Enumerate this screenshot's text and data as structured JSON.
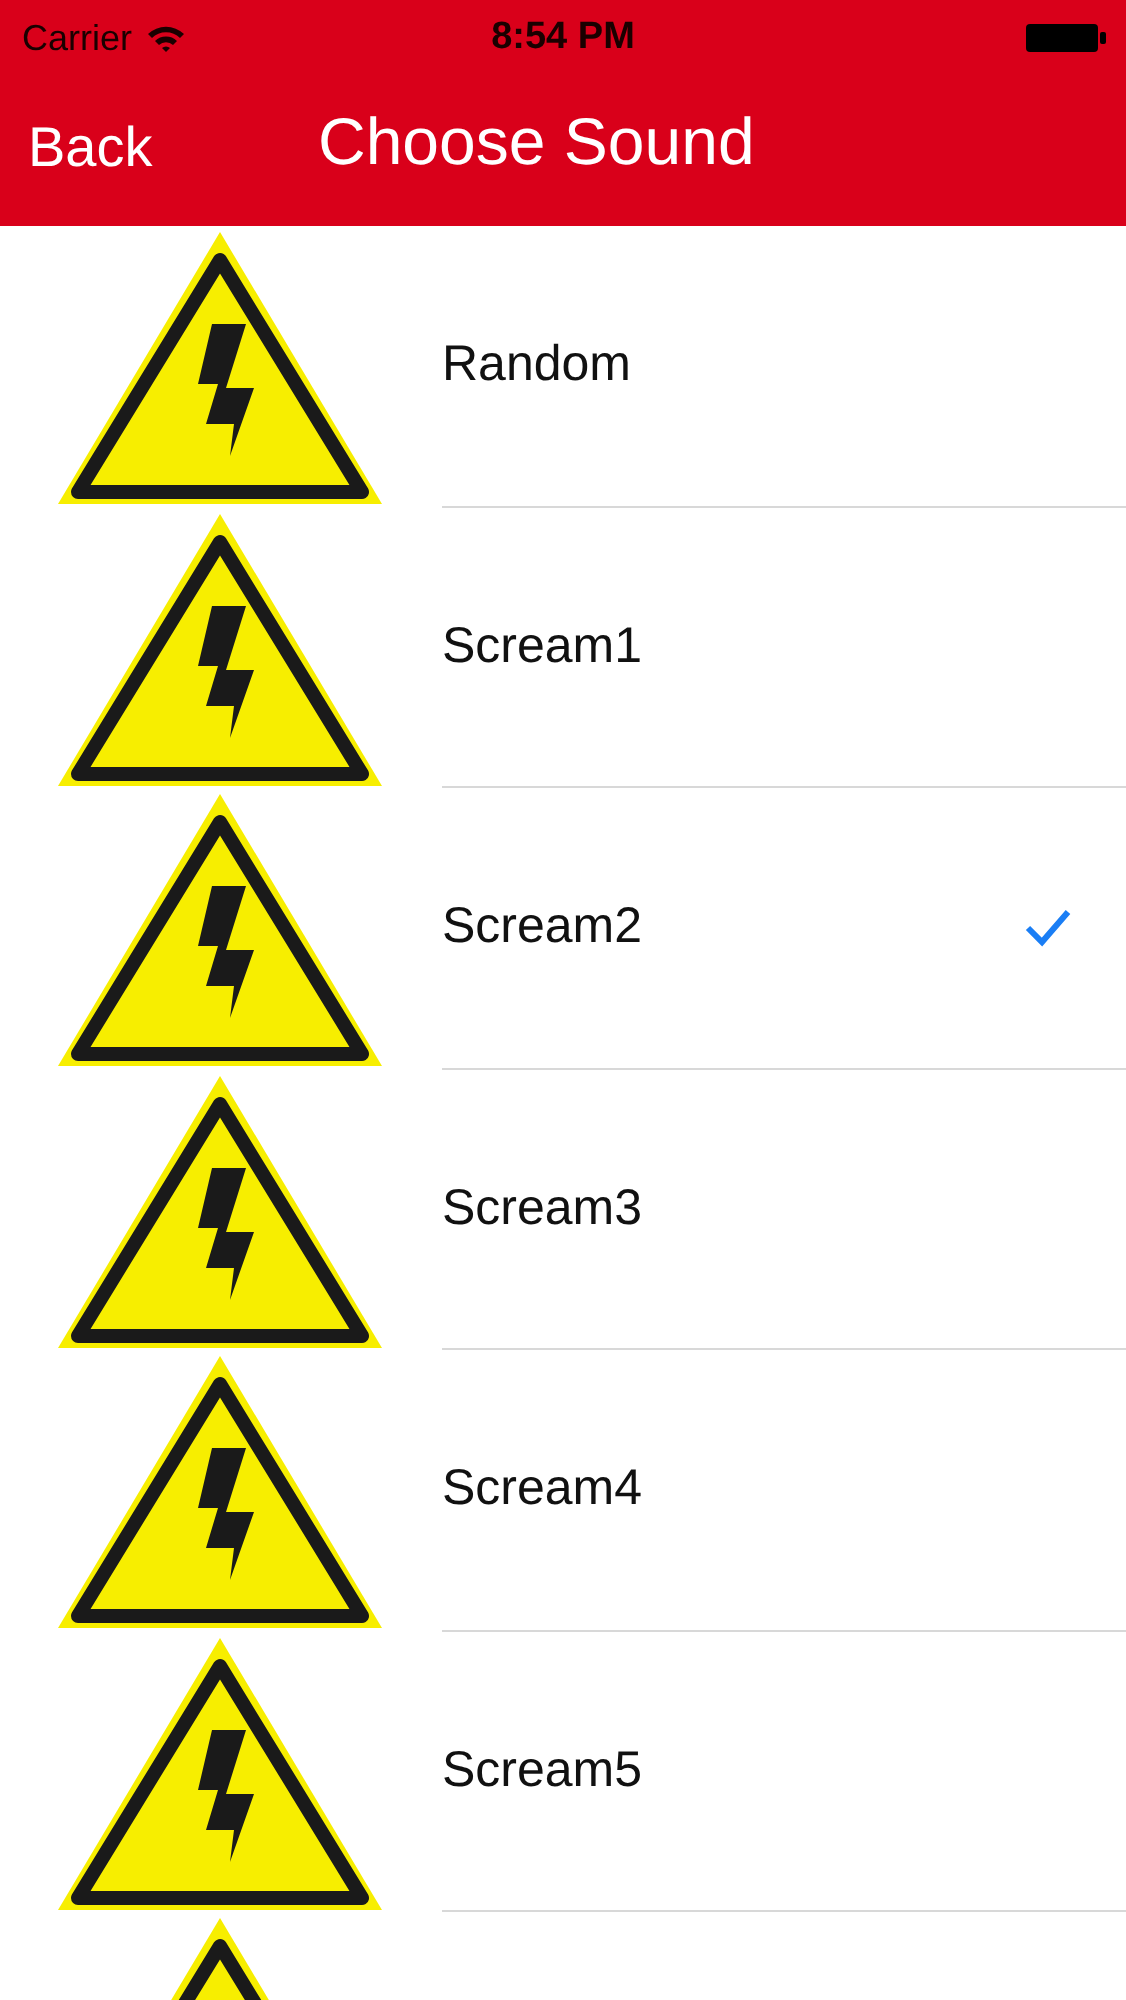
{
  "status_bar": {
    "carrier": "Carrier",
    "time": "8:54 PM"
  },
  "nav_bar": {
    "back": "Back",
    "title": "Choose Sound"
  },
  "sounds": [
    {
      "label": "Random",
      "selected": false
    },
    {
      "label": "Scream1",
      "selected": false
    },
    {
      "label": "Scream2",
      "selected": true
    },
    {
      "label": "Scream3",
      "selected": false
    },
    {
      "label": "Scream4",
      "selected": false
    },
    {
      "label": "Scream5",
      "selected": false
    }
  ]
}
